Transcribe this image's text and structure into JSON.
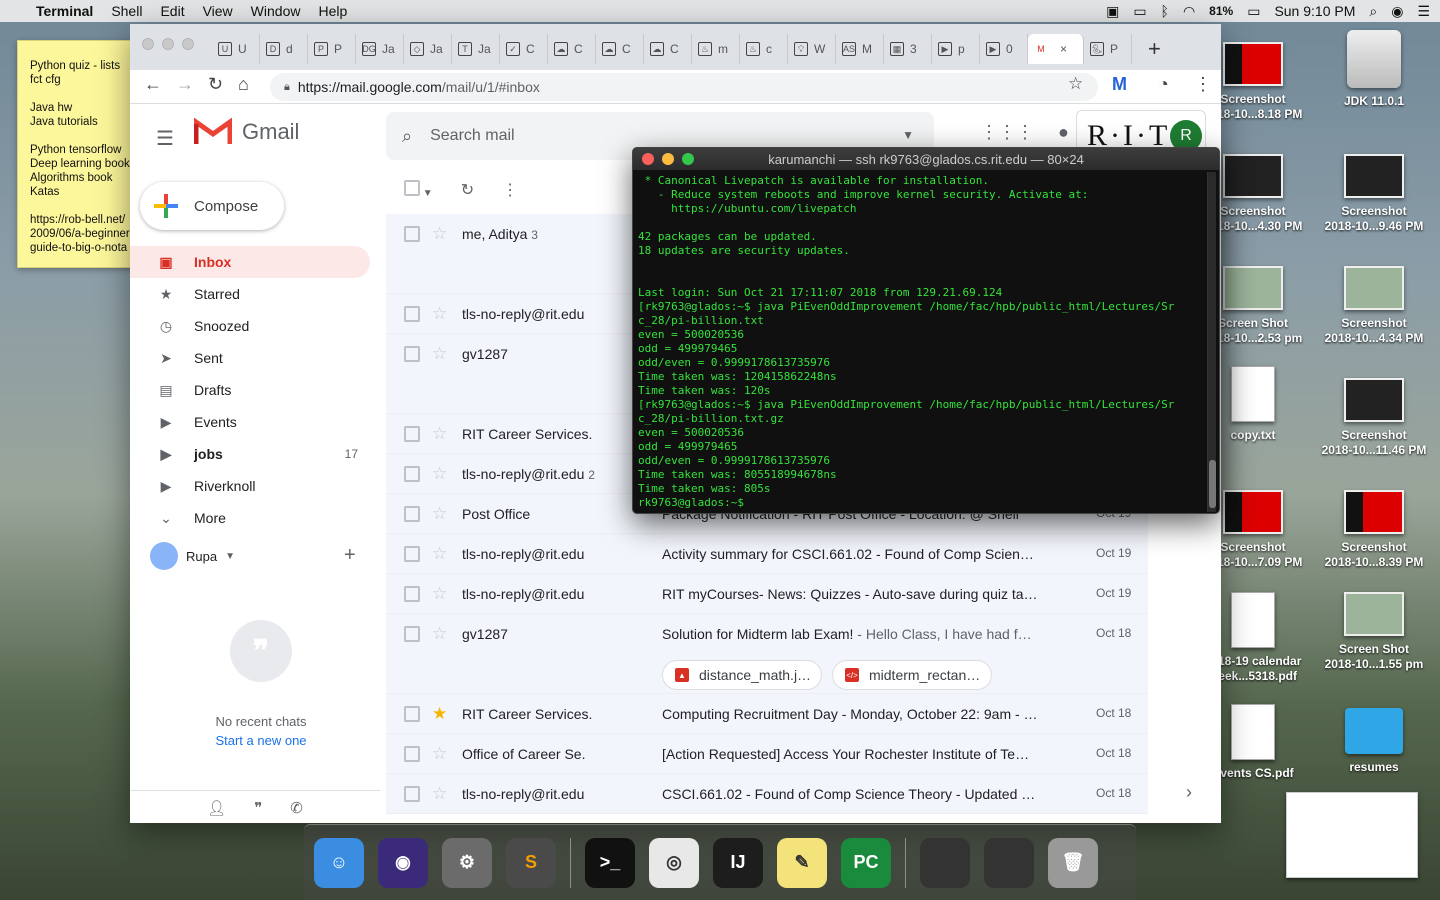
{
  "menubar": {
    "app": "Terminal",
    "menus": [
      "Shell",
      "Edit",
      "View",
      "Window",
      "Help"
    ],
    "battery": "81%",
    "clock": "Sun 9:10 PM"
  },
  "sticky": {
    "text": "Python quiz - lists\nfct cfg\n\nJava hw\nJava tutorials\n\nPython tensorflow\nDeep learning book\nAlgorithms book\nKatas\n\nhttps://rob-bell.net/\n2009/06/a-beginner\nguide-to-big-o-nota"
  },
  "chrome": {
    "tabs": [
      "U",
      "d",
      "P",
      "Ja",
      "Ja",
      "Ja",
      "C",
      "C",
      "C",
      "C",
      "m",
      "c",
      "W",
      "M",
      "3",
      "p",
      "0",
      "",
      "P"
    ],
    "url_host": "https://mail.google.com",
    "url_path": "/mail/u/1/#inbox"
  },
  "gmail": {
    "logo_text": "Gmail",
    "search_placeholder": "Search mail",
    "rit_logo": "R·I·T",
    "avatar_initial": "R",
    "compose": "Compose",
    "nav": [
      {
        "label": "Inbox",
        "count": ""
      },
      {
        "label": "Starred",
        "count": ""
      },
      {
        "label": "Snoozed",
        "count": ""
      },
      {
        "label": "Sent",
        "count": ""
      },
      {
        "label": "Drafts",
        "count": ""
      },
      {
        "label": "Events",
        "count": ""
      },
      {
        "label": "jobs",
        "count": "17"
      },
      {
        "label": "Riverknoll",
        "count": ""
      },
      {
        "label": "More",
        "count": ""
      }
    ],
    "chat_user": "Rupa",
    "no_recent": "No recent chats",
    "start_new": "Start a new one",
    "emails": [
      {
        "sender": "me, Aditya",
        "n": "3",
        "subject": "",
        "snippet": "",
        "date": ""
      },
      {
        "sender": "tls-no-reply@rit.edu",
        "n": "",
        "subject": "",
        "snippet": "",
        "date": ""
      },
      {
        "sender": "gv1287",
        "n": "",
        "subject": "",
        "snippet": "",
        "date": ""
      },
      {
        "sender": "RIT Career Services.",
        "n": "",
        "subject": "",
        "snippet": "",
        "date": ""
      },
      {
        "sender": "tls-no-reply@rit.edu",
        "n": "2",
        "subject": "",
        "snippet": "",
        "date": ""
      },
      {
        "sender": "Post Office",
        "n": "",
        "subject": "Package Notification - RIT Post Office - Location: @ Shell",
        "snippet": "",
        "date": "Oct 19"
      },
      {
        "sender": "tls-no-reply@rit.edu",
        "n": "",
        "subject": "Activity summary for CSCI.661.02 - Found of Comp Scien…",
        "snippet": "",
        "date": "Oct 19"
      },
      {
        "sender": "tls-no-reply@rit.edu",
        "n": "",
        "subject": "RIT myCourses- News: Quizzes - Auto-save during quiz ta…",
        "snippet": "",
        "date": "Oct 19"
      },
      {
        "sender": "gv1287",
        "n": "",
        "subject": "Solution for Midterm lab Exam!",
        "snippet": " - Hello Class, I have had f…",
        "date": "Oct 18"
      },
      {
        "sender": "RIT Career Services.",
        "n": "",
        "subject": "Computing Recruitment Day - Monday, October 22: 9am - …",
        "snippet": "",
        "date": "Oct 18"
      },
      {
        "sender": "Office of Career Se.",
        "n": "",
        "subject": "[Action Requested] Access Your Rochester Institute of Te…",
        "snippet": "",
        "date": "Oct 18"
      },
      {
        "sender": "tls-no-reply@rit.edu",
        "n": "",
        "subject": "CSCI.661.02 - Found of Comp Science Theory - Updated …",
        "snippet": "",
        "date": "Oct 18"
      }
    ],
    "attachments": [
      "distance_math.j…",
      "midterm_rectan…"
    ]
  },
  "terminal": {
    "title": "karumanchi — ssh rk9763@glados.cs.rit.edu — 80×24",
    "output": " * Canonical Livepatch is available for installation.\n   - Reduce system reboots and improve kernel security. Activate at:\n     https://ubuntu.com/livepatch\n\n42 packages can be updated.\n18 updates are security updates.\n\n\nLast login: Sun Oct 21 17:11:07 2018 from 129.21.69.124\n[rk9763@glados:~$ java PiEvenOddImprovement /home/fac/hpb/public_html/Lectures/Sr\nc_28/pi-billion.txt\neven = 500020536\nodd = 499979465\nodd/even = 0.9999178613735976\nTime taken was: 120415862248ns\nTime taken was: 120s\n[rk9763@glados:~$ java PiEvenOddImprovement /home/fac/hpb/public_html/Lectures/Sr\nc_28/pi-billion.txt.gz\neven = 500020536\nodd = 499979465\nodd/even = 0.9999178613735976\nTime taken was: 805518994678ns\nTime taken was: 805s\nrk9763@glados:~$ "
  },
  "desktop": [
    {
      "label": "Screenshot\n2018-10...8.18 PM",
      "kind": "red"
    },
    {
      "label": "JDK 11.0.1",
      "kind": "drive"
    },
    {
      "label": "Screenshot\n2018-10...4.30 PM",
      "kind": "dark"
    },
    {
      "label": "Screenshot\n2018-10...9.46 PM",
      "kind": "dark"
    },
    {
      "label": "Screen Shot\n2018-10...2.53 pm",
      "kind": "green"
    },
    {
      "label": "Screenshot\n2018-10...4.34 PM",
      "kind": "green"
    },
    {
      "label": "copy.txt",
      "kind": "doc"
    },
    {
      "label": "Screenshot\n2018-10...11.46 PM",
      "kind": "dark"
    },
    {
      "label": "Screenshot\n2018-10...7.09 PM",
      "kind": "red"
    },
    {
      "label": "Screenshot\n2018-10...8.39 PM",
      "kind": "red"
    },
    {
      "label": "2018-19 calendar\nweek...5318.pdf",
      "kind": "doc"
    },
    {
      "label": "Screen Shot\n2018-10...1.55 pm",
      "kind": "green"
    },
    {
      "label": "Events CS.pdf",
      "kind": "doc"
    },
    {
      "label": "resumes",
      "kind": "folder"
    }
  ],
  "dock": [
    "Finder",
    "Siri",
    "System Preferences",
    "Sublime Text",
    "Terminal",
    "Chrome",
    "IntelliJ IDEA",
    "Stickies",
    "PyCharm",
    "Trash"
  ]
}
